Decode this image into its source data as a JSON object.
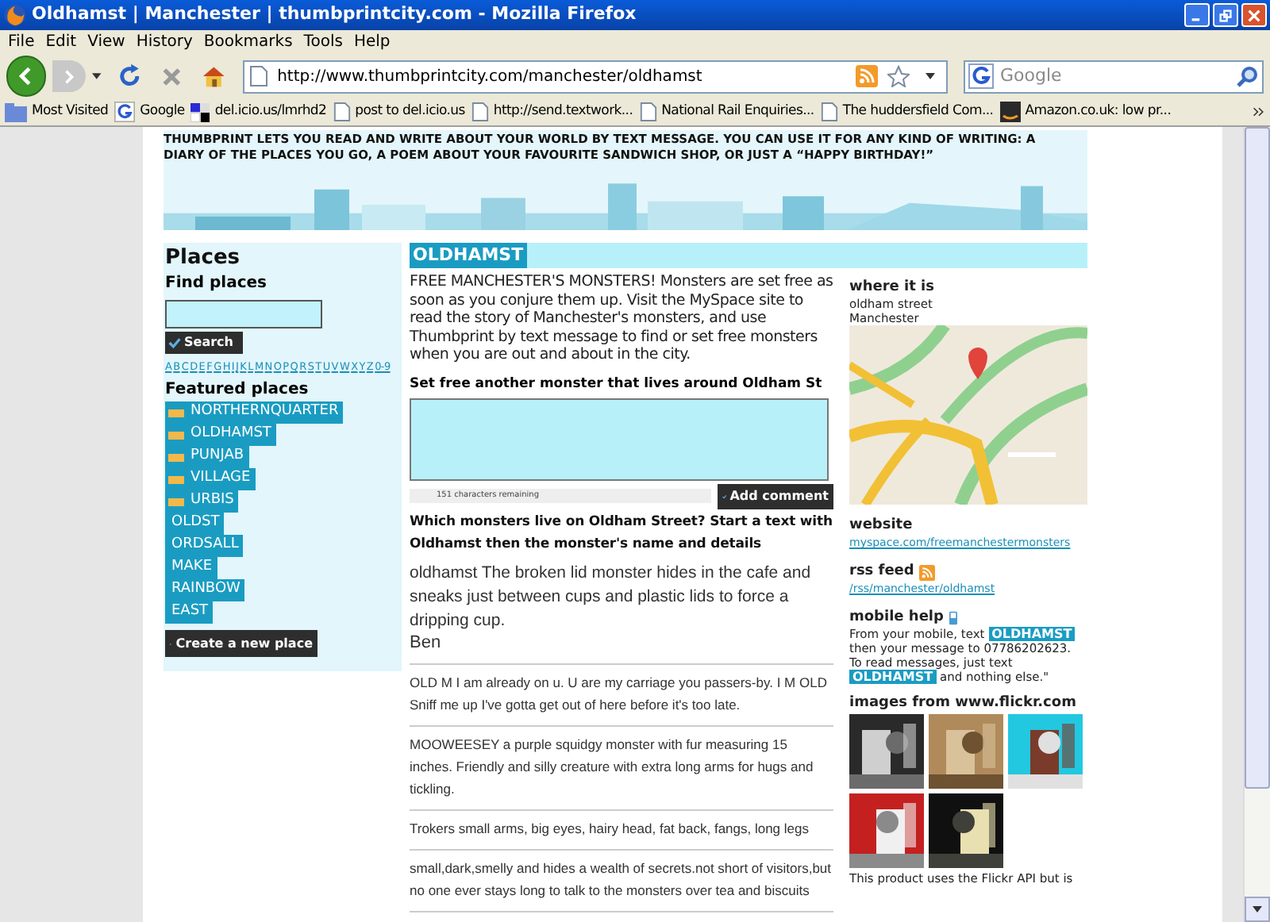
{
  "window": {
    "title": "Oldhamst | Manchester | thumbprintcity.com - Mozilla Firefox"
  },
  "menu": [
    "File",
    "Edit",
    "View",
    "History",
    "Bookmarks",
    "Tools",
    "Help"
  ],
  "address": {
    "value": "http://www.thumbprintcity.com/manchester/oldhamst"
  },
  "search": {
    "placeholder": "Google"
  },
  "bookmarks": [
    {
      "label": "Most Visited",
      "kind": "folder"
    },
    {
      "label": "Google",
      "kind": "google"
    },
    {
      "label": "del.icio.us/lmrhd2",
      "kind": "delicious"
    },
    {
      "label": "post to del.icio.us",
      "kind": "page"
    },
    {
      "label": "http://send.textwork...",
      "kind": "page"
    },
    {
      "label": "National Rail Enquiries...",
      "kind": "page"
    },
    {
      "label": "The huddersfield Com...",
      "kind": "page"
    },
    {
      "label": "Amazon.co.uk: low pr...",
      "kind": "amazon"
    }
  ],
  "banner": {
    "text": "THUMBPRINT LETS YOU READ AND WRITE ABOUT YOUR WORLD BY TEXT MESSAGE. YOU CAN USE IT FOR ANY KIND OF WRITING: A DIARY OF THE PLACES YOU GO, A POEM ABOUT YOUR FAVOURITE SANDWICH SHOP, OR JUST A “HAPPY BIRTHDAY!”"
  },
  "sidebar": {
    "title": "Places",
    "find_label": "Find places",
    "search_button": "Search",
    "letters": [
      "A",
      "B",
      "C",
      "D",
      "E",
      "F",
      "G",
      "H",
      "I",
      "J",
      "K",
      "L",
      "M",
      "N",
      "O",
      "P",
      "Q",
      "R",
      "S",
      "T",
      "U",
      "V",
      "W",
      "X",
      "Y",
      "Z",
      "0-9"
    ],
    "featured_label": "Featured places",
    "places": [
      {
        "name": "NORTHERNQUARTER",
        "new": true
      },
      {
        "name": "OLDHAMST",
        "new": true
      },
      {
        "name": "PUNJAB",
        "new": true
      },
      {
        "name": "VILLAGE",
        "new": true
      },
      {
        "name": "URBIS",
        "new": true
      },
      {
        "name": "OLDST",
        "new": false
      },
      {
        "name": "ORDSALL",
        "new": false
      },
      {
        "name": "MAKE",
        "new": false
      },
      {
        "name": "RAINBOW",
        "new": false
      },
      {
        "name": "EAST",
        "new": false
      }
    ],
    "create_button": "Create a new place"
  },
  "main": {
    "heading": "OLDHAMST",
    "intro": "FREE MANCHESTER'S MONSTERS! Monsters are set free as soon as you conjure them up. Visit the MySpace site to read the story of Manchester's monsters, and use Thumbprint by text message to find or set free monsters when you are out and about in the city.",
    "form_label": "Set free another monster that lives around Oldham St",
    "chars_remaining": "151 characters remaining",
    "add_button": "Add comment",
    "prompt": "Which monsters live on Oldham Street? Start a text with Oldhamst then the monster's name and details",
    "comments": [
      {
        "kind": "latest",
        "text": "oldhamst The broken lid monster hides in the cafe and sneaks just between cups and plastic lids to force a dripping cup.",
        "author": "Ben"
      },
      {
        "kind": "older",
        "text": "OLD M I am already on u. U are my carriage you passers-by. I M OLD Sniff me up I've gotta get out of here before it's too late."
      },
      {
        "kind": "older",
        "text": "MOOWEESEY a purple squidgy monster with fur measuring 15 inches. Friendly and silly creature with extra long arms for hugs and tickling."
      },
      {
        "kind": "older",
        "text": "Trokers small arms, big eyes, hairy head, fat back, fangs, long legs"
      },
      {
        "kind": "older",
        "text": "small,dark,smelly and hides a wealth of secrets.not short of visitors,but no one ever stays long to talk to the monsters over tea and biscuits"
      }
    ]
  },
  "info": {
    "where_title": "where it is",
    "address_lines": [
      "oldham street",
      "Manchester"
    ],
    "website_title": "website",
    "website_link": "myspace.com/freemanchestermonsters",
    "rss_title": "rss feed",
    "rss_link": "/rss/manchester/oldhamst",
    "mobile_title": "mobile help",
    "mobile_paragraphs": [
      [
        {
          "kind": "plain",
          "text": "From your mobile, text "
        },
        {
          "kind": "tag",
          "text": "OLDHAMST"
        },
        {
          "kind": "plain",
          "text": " then your message to 07786202623."
        }
      ],
      [
        {
          "kind": "plain",
          "text": "To read messages, just text "
        },
        {
          "kind": "tag",
          "text": "OLDHAMST"
        },
        {
          "kind": "plain",
          "text": " and nothing else.\""
        }
      ]
    ],
    "images_title": "images from www.flickr.com",
    "images": [
      {
        "kind": "picture"
      },
      {
        "kind": "picture"
      },
      {
        "kind": "picture"
      },
      {
        "kind": "picture"
      },
      {
        "kind": "picture"
      }
    ],
    "flickr_note": "This product uses the Flickr API but is"
  }
}
